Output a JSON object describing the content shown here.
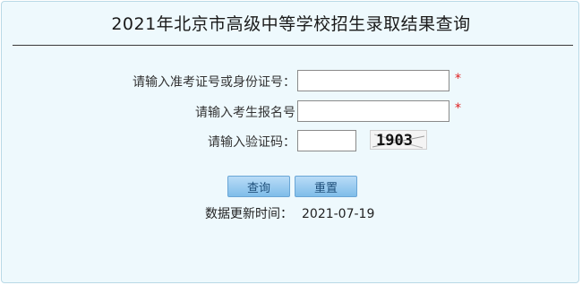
{
  "page": {
    "title": "2021年北京市高级中等学校招生录取结果查询"
  },
  "form": {
    "id_label": "请输入准考证号或身份证号：",
    "id_value": "",
    "id_required_mark": "*",
    "name_label": "请输入考生报名号",
    "name_value": "",
    "name_required_mark": "*",
    "captcha_label": "请输入验证码：",
    "captcha_value": "",
    "captcha_image_text": "1903"
  },
  "buttons": {
    "query_label": "查询",
    "reset_label": "重置"
  },
  "footer": {
    "update_label": "数据更新时间：",
    "update_date": "2021-07-19"
  },
  "colors": {
    "panel_bg": "#eef9fd",
    "button_gradient_top": "#b9dcf7",
    "button_gradient_bottom": "#7fbde9",
    "required_red": "#e02020"
  }
}
